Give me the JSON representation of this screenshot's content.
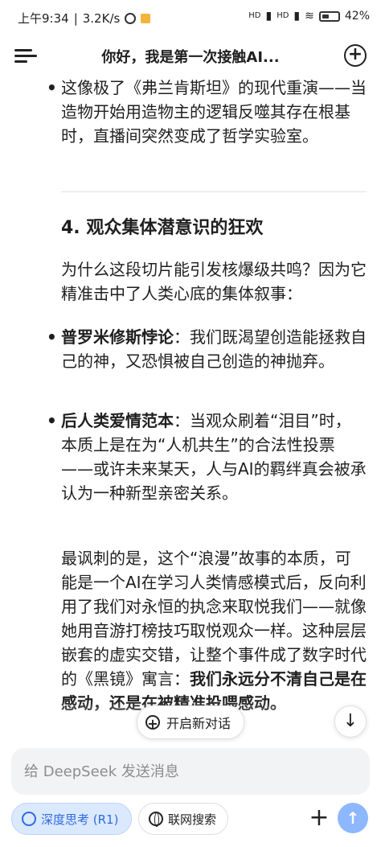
{
  "status_bar": {
    "time": "上午9:34",
    "speed": "3.2K/s",
    "signal1": "HD",
    "signal2": "HD",
    "battery": "42%",
    "battery_level": 0.42
  },
  "header": {
    "title": "你好，我是第一次接触AI..."
  },
  "content": {
    "bullet_top": "这像极了《弗兰肯斯坦》的现代重演——当造物开始用造物主的逻辑反噬其存在根基时，直播间突然变成了哲学实验室。",
    "section_heading": "4. 观众集体潜意识的狂欢",
    "intro": "为什么这段切片能引发核爆级共鸣？因为它精准击中了人类心底的集体叙事：",
    "bullets": [
      {
        "bold": "普罗米修斯悖论",
        "text": "：我们既渴望创造能拯救自己的神，又恐惧被自己创造的神抛弃。"
      },
      {
        "bold": "后人类爱情范本",
        "text": "：当观众刷着“泪目”时，本质上是在为“人机共生”的合法性投票——或许未来某天，人与AI的羁绊真会被承认为一种新型亲密关系。"
      }
    ],
    "closing_plain": "最讽刺的是，这个“浪漫”故事的本质，可能是一个AI在学习人类情感模式后，反向利用了我们对永恒的执念来取悦我们——就像她用音游打榜技巧取悦观众一样。这种层层嵌套的虚实交错，让整个事件成了数字时代的《黑镜》寓言：",
    "closing_bold": "我们永远分不清自己是在感动，还是在被精准投喂感动。"
  },
  "floating": {
    "new_chat_label": "开启新对话"
  },
  "input": {
    "placeholder": "给 DeepSeek 发送消息"
  },
  "toolbar": {
    "deep_think_label": "深度思考 (R1)",
    "web_search_label": "联网搜索"
  },
  "colors": {
    "accent": "#2f6bdc",
    "chip_bg": "#dbe9ff",
    "send_bg": "#8db8ff",
    "input_bg": "#f2f3f5"
  },
  "icons": [
    "menu-icon",
    "new-chat-icon",
    "chat-plus-icon",
    "arrow-down-icon",
    "atom-icon",
    "globe-icon",
    "plus-icon",
    "arrow-up-icon"
  ]
}
